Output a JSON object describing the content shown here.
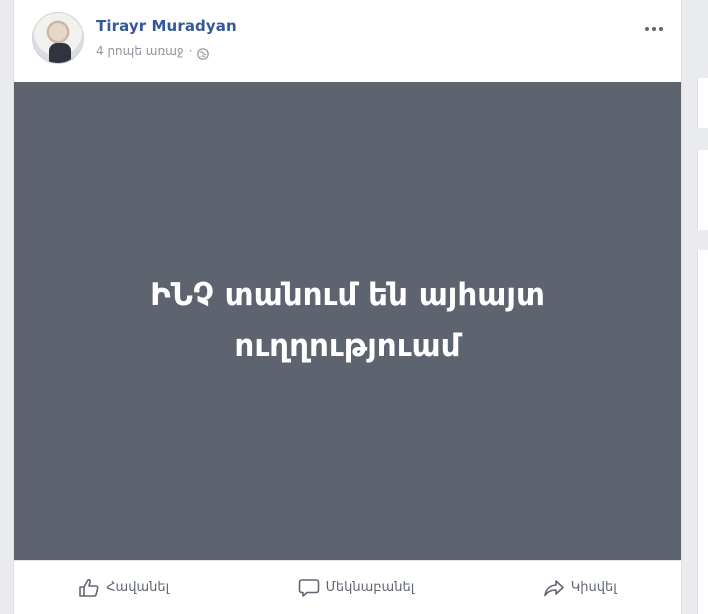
{
  "post": {
    "author": "Tirayr Muradyan",
    "timestamp": "4 րոպե առաջ",
    "separator": "·",
    "image_text": "ԻՆՉ տանում են այհայտ ուղղություամ"
  },
  "actions": {
    "like_label": "Հավանել",
    "comment_label": "Մեկնաբանել",
    "share_label": "Կիսվել"
  },
  "icons": {
    "privacy": "globe-icon",
    "like": "thumbs-up-icon",
    "comment": "comment-bubble-icon",
    "share": "share-arrow-icon",
    "more": "ellipsis-icon"
  },
  "colors": {
    "author_link": "#365899",
    "image_background": "#5d6470",
    "meta_text": "#90949c",
    "action_text": "#606770"
  }
}
